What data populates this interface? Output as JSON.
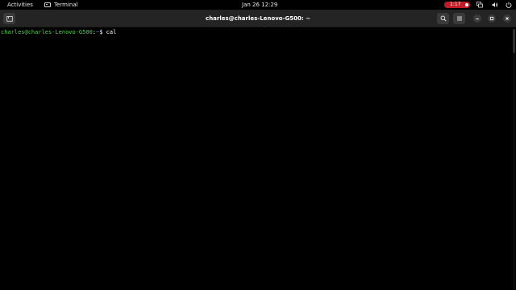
{
  "topbar": {
    "activities_label": "Activities",
    "app_name": "Terminal",
    "clock": "Jan 26  12:29",
    "recording_time": "1:17"
  },
  "headerbar": {
    "title": "charles@charles-Lenovo-G500: ~"
  },
  "terminal": {
    "prompt_user_host": "charles@charles-Lenovo-G500",
    "prompt_separator": ":",
    "prompt_path": "~",
    "prompt_symbol": "$ ",
    "command": "cal"
  },
  "colors": {
    "prompt_user": "#4fd34f",
    "prompt_path": "#5a8fe0",
    "recording_pill": "#c01c28",
    "headerbar": "#242424"
  },
  "icons": {
    "new_tab": "new-tab-icon",
    "search": "search-icon",
    "menu": "hamburger-menu-icon",
    "minimize": "minimize-icon",
    "maximize": "maximize-icon",
    "close": "close-icon",
    "network": "network-icon",
    "volume": "volume-icon",
    "power": "power-icon",
    "screen": "screen-icon"
  }
}
